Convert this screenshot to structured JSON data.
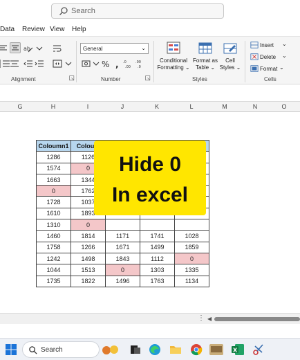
{
  "titlebar": {
    "search_placeholder": "Search"
  },
  "menu": {
    "tabs": [
      "Data",
      "Review",
      "View",
      "Help"
    ]
  },
  "ribbon": {
    "number_format": "General",
    "groups": {
      "alignment": "Alignment",
      "number": "Number",
      "styles": "Styles",
      "cells": "Cells"
    },
    "styles": {
      "conditional_1": "Conditional",
      "conditional_2": "Formatting",
      "format_table_1": "Format as",
      "format_table_2": "Table",
      "cell_styles_1": "Cell",
      "cell_styles_2": "Styles"
    },
    "cells": {
      "insert": "Insert",
      "delete": "Delete",
      "format": "Format"
    }
  },
  "columns": [
    "G",
    "H",
    "I",
    "J",
    "K",
    "L",
    "M",
    "N",
    "O"
  ],
  "table": {
    "headers": [
      "Coloumn1",
      "Coloum",
      "",
      "",
      ""
    ],
    "rows": [
      [
        "1286",
        "1126",
        "",
        "",
        ""
      ],
      [
        "1574",
        "0",
        "",
        "",
        ""
      ],
      [
        "1663",
        "1344",
        "",
        "",
        ""
      ],
      [
        "0",
        "1762",
        "",
        "",
        ""
      ],
      [
        "1728",
        "1037",
        "",
        "",
        ""
      ],
      [
        "1610",
        "1893",
        "",
        "",
        ""
      ],
      [
        "1310",
        "0",
        "",
        "",
        ""
      ],
      [
        "1460",
        "1814",
        "1171",
        "1741",
        "1028"
      ],
      [
        "1758",
        "1266",
        "1671",
        "1499",
        "1859"
      ],
      [
        "1242",
        "1498",
        "1843",
        "1112",
        "0"
      ],
      [
        "1044",
        "1513",
        "0",
        "1303",
        "1335"
      ],
      [
        "1735",
        "1822",
        "1496",
        "1763",
        "1134"
      ]
    ]
  },
  "overlay": {
    "line1": "Hide 0",
    "line2": "In excel"
  },
  "taskbar": {
    "search_label": "Search"
  },
  "colors": {
    "header_fill": "#b7d6ee",
    "zero_fill": "#f4c7c9",
    "overlay": "#ffe600",
    "excel_green": "#107c41"
  }
}
